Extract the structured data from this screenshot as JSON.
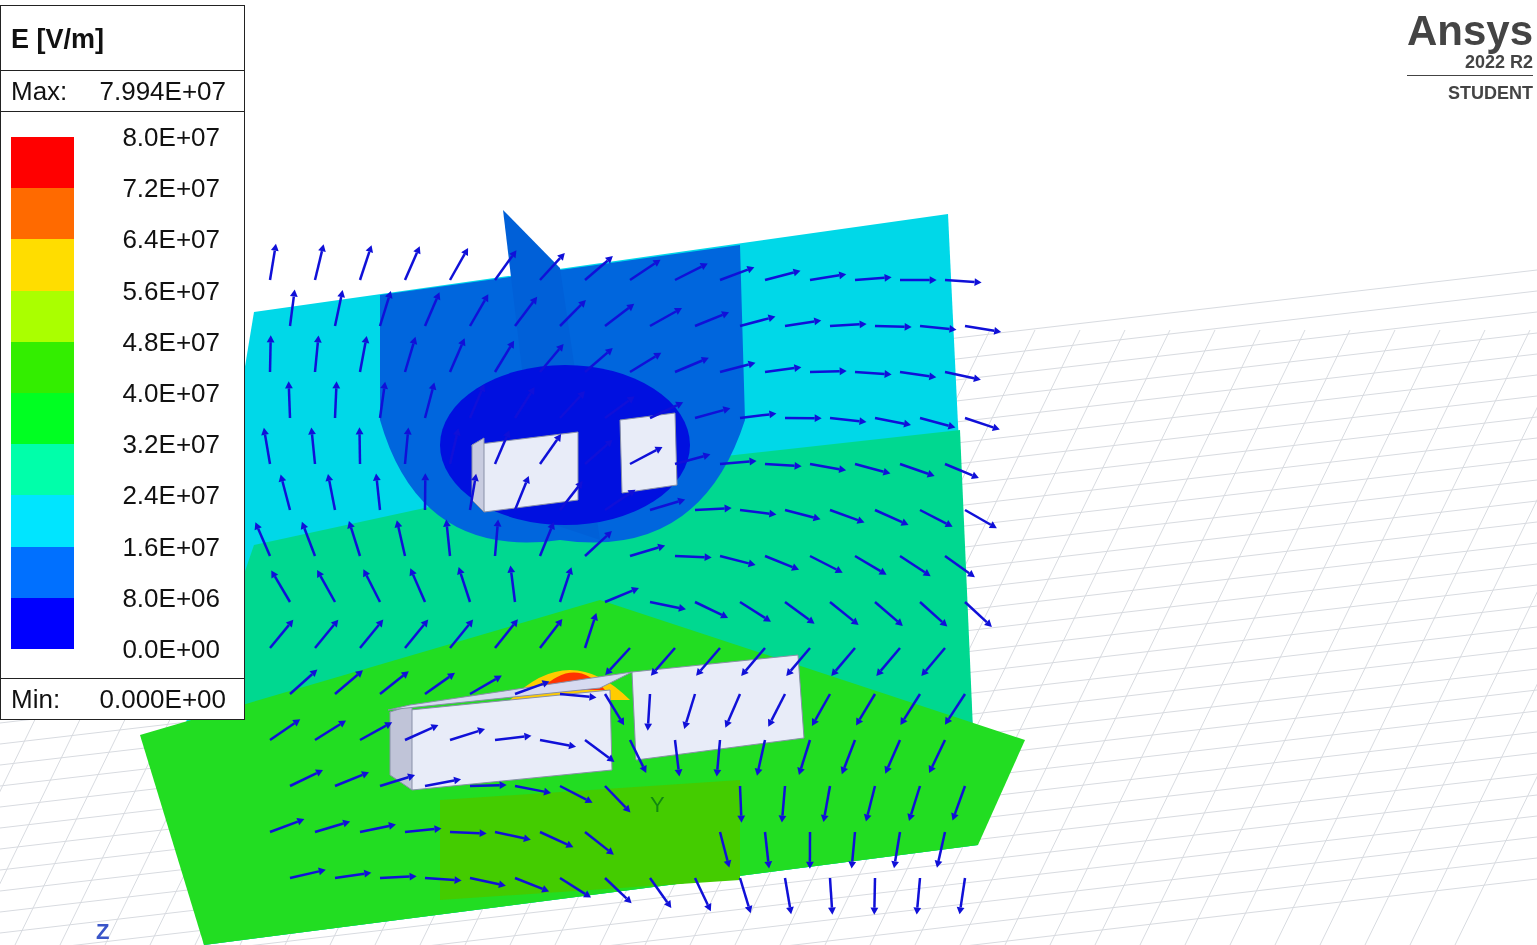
{
  "legend": {
    "title": "E [V/m]",
    "max_label": "Max:",
    "max_value": "7.994E+07",
    "bands": [
      {
        "color": "#ff0000"
      },
      {
        "color": "#ff6a00"
      },
      {
        "color": "#ffdd00"
      },
      {
        "color": "#aaff00"
      },
      {
        "color": "#33ee00"
      },
      {
        "color": "#00ff22"
      },
      {
        "color": "#00ffaa"
      },
      {
        "color": "#00e5ff"
      },
      {
        "color": "#0070ff"
      },
      {
        "color": "#0000ff"
      }
    ],
    "ticks": [
      "8.0E+07",
      "7.2E+07",
      "6.4E+07",
      "5.6E+07",
      "4.8E+07",
      "4.0E+07",
      "3.2E+07",
      "2.4E+07",
      "1.6E+07",
      "8.0E+06",
      "0.0E+00"
    ],
    "min_label": "Min:",
    "min_value": "0.000E+00"
  },
  "logo": {
    "name": "Ansys",
    "version": "2022 R2",
    "edition": "STUDENT"
  },
  "axes": [
    {
      "label": "Y"
    },
    {
      "label": "Z"
    }
  ]
}
